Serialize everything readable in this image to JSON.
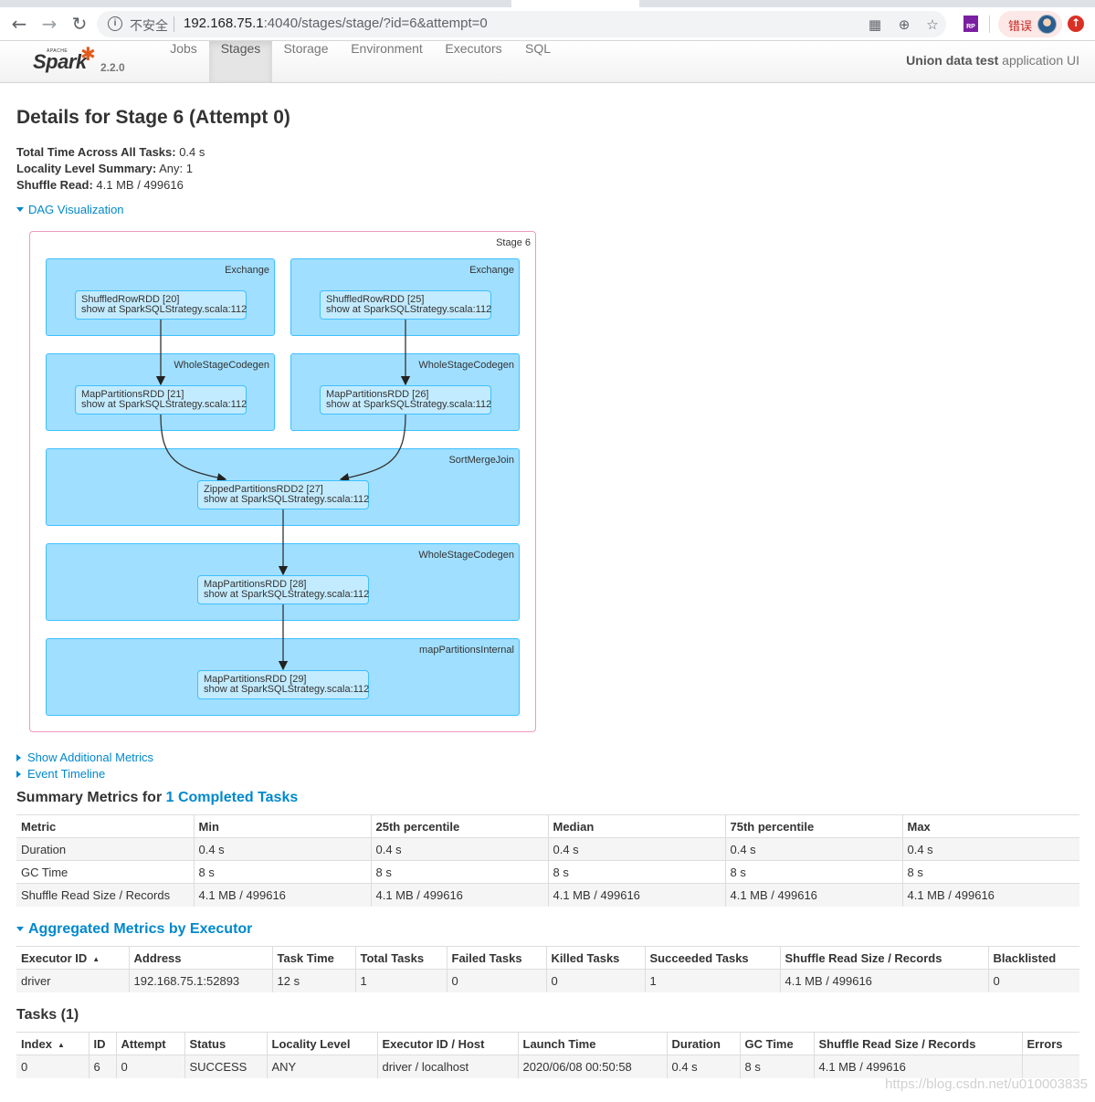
{
  "browser": {
    "url_insecure": "不安全",
    "url_host": "192.168.75.1",
    "url_path": ":4040/stages/stage/?id=6&attempt=0",
    "error_label": "错误",
    "ext_label": "RP"
  },
  "navbar": {
    "brand_apache": "APACHE",
    "brand_spark": "Spark",
    "version": "2.2.0",
    "items": [
      "Jobs",
      "Stages",
      "Storage",
      "Environment",
      "Executors",
      "SQL"
    ],
    "active": "Stages",
    "app_name_bold": "Union data test",
    "app_name_rest": " application UI"
  },
  "page": {
    "title": "Details for Stage 6 (Attempt 0)",
    "summary": [
      {
        "label": "Total Time Across All Tasks:",
        "value": " 0.4 s"
      },
      {
        "label": "Locality Level Summary:",
        "value": " Any: 1"
      },
      {
        "label": "Shuffle Read:",
        "value": " 4.1 MB / 499616"
      }
    ],
    "dag_toggle": "DAG Visualization",
    "show_metrics": "Show Additional Metrics",
    "event_timeline": "Event Timeline"
  },
  "dag": {
    "stage_label": "Stage 6",
    "clusters": [
      "Exchange",
      "Exchange",
      "WholeStageCodegen",
      "WholeStageCodegen",
      "SortMergeJoin",
      "WholeStageCodegen",
      "mapPartitionsInternal"
    ],
    "nodes": [
      {
        "name": "ShuffledRowRDD [20]",
        "callsite": "show at SparkSQLStrategy.scala:112"
      },
      {
        "name": "ShuffledRowRDD [25]",
        "callsite": "show at SparkSQLStrategy.scala:112"
      },
      {
        "name": "MapPartitionsRDD [21]",
        "callsite": "show at SparkSQLStrategy.scala:112"
      },
      {
        "name": "MapPartitionsRDD [26]",
        "callsite": "show at SparkSQLStrategy.scala:112"
      },
      {
        "name": "ZippedPartitionsRDD2 [27]",
        "callsite": "show at SparkSQLStrategy.scala:112"
      },
      {
        "name": "MapPartitionsRDD [28]",
        "callsite": "show at SparkSQLStrategy.scala:112"
      },
      {
        "name": "MapPartitionsRDD [29]",
        "callsite": "show at SparkSQLStrategy.scala:112"
      }
    ]
  },
  "summary_metrics": {
    "heading_prefix": "Summary Metrics for ",
    "heading_link": "1 Completed Tasks",
    "columns": [
      "Metric",
      "Min",
      "25th percentile",
      "Median",
      "75th percentile",
      "Max"
    ],
    "rows": [
      [
        "Duration",
        "0.4 s",
        "0.4 s",
        "0.4 s",
        "0.4 s",
        "0.4 s"
      ],
      [
        "GC Time",
        "8 s",
        "8 s",
        "8 s",
        "8 s",
        "8 s"
      ],
      [
        "Shuffle Read Size / Records",
        "4.1 MB / 499616",
        "4.1 MB / 499616",
        "4.1 MB / 499616",
        "4.1 MB / 499616",
        "4.1 MB / 499616"
      ]
    ]
  },
  "executors": {
    "heading": "Aggregated Metrics by Executor",
    "columns": [
      "Executor ID",
      "Address",
      "Task Time",
      "Total Tasks",
      "Failed Tasks",
      "Killed Tasks",
      "Succeeded Tasks",
      "Shuffle Read Size / Records",
      "Blacklisted"
    ],
    "rows": [
      [
        "driver",
        "192.168.75.1:52893",
        "12 s",
        "1",
        "0",
        "0",
        "1",
        "4.1 MB / 499616",
        "0"
      ]
    ]
  },
  "tasks": {
    "heading": "Tasks (1)",
    "columns": [
      "Index",
      "ID",
      "Attempt",
      "Status",
      "Locality Level",
      "Executor ID / Host",
      "Launch Time",
      "Duration",
      "GC Time",
      "Shuffle Read Size / Records",
      "Errors"
    ],
    "rows": [
      [
        "0",
        "6",
        "0",
        "SUCCESS",
        "ANY",
        "driver / localhost",
        "2020/06/08 00:50:58",
        "0.4 s",
        "8 s",
        "4.1 MB / 499616",
        ""
      ]
    ]
  },
  "watermark": "https://blog.csdn.net/u010003835",
  "colors": {
    "link": "#0088cc",
    "cluster_fill": "#a0dfff",
    "node_fill": "#c3ebff",
    "stage_border": "#ef9abf",
    "spark_orange": "#e25a1c"
  }
}
